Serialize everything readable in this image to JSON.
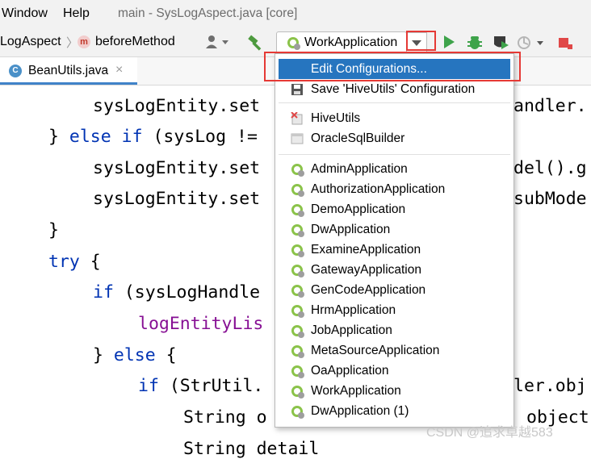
{
  "menubar": {
    "window_menu": "Window",
    "help_menu": "Help",
    "title": "main - SysLogAspect.java [core]"
  },
  "navbar": {
    "crumb_class": "LogAspect",
    "crumb_separator": "〉",
    "crumb_method": "beforeMethod",
    "method_icon": "m",
    "run_config": "WorkApplication"
  },
  "editor_tab": {
    "file_icon": "C",
    "label": "BeanUtils.java",
    "close": "×"
  },
  "code_lines": [
    {
      "parts": [
        "sysLogEntity.set"
      ]
    },
    {
      "parts": [
        "} ",
        "else",
        " ",
        "if",
        " (sysLog !="
      ]
    },
    {
      "parts": [
        "sysLogEntity.set"
      ]
    },
    {
      "parts": [
        "sysLogEntity.set"
      ]
    },
    {
      "parts": [
        "}"
      ]
    },
    {
      "parts": [
        "try",
        " {"
      ]
    },
    {
      "parts": [
        "if",
        " (sysLogHandle"
      ]
    },
    {
      "parts": [
        "logEntityLis"
      ]
    },
    {
      "parts": [
        "} ",
        "else",
        " {"
      ]
    },
    {
      "parts": [
        "if",
        " (StrUtil."
      ]
    },
    {
      "parts": [
        "String o"
      ]
    },
    {
      "parts": [
        "String detail"
      ]
    }
  ],
  "code_right": [
    "andler.",
    "del().g",
    "subMode",
    "ler.obj",
    "object"
  ],
  "dropdown": {
    "edit_configurations": "Edit Configurations...",
    "save_configuration": "Save 'HiveUtils' Configuration",
    "temporary": [
      "HiveUtils",
      "OracleSqlBuilder"
    ],
    "applications": [
      "AdminApplication",
      "AuthorizationApplication",
      "DemoApplication",
      "DwApplication",
      "ExamineApplication",
      "GatewayApplication",
      "GenCodeApplication",
      "HrmApplication",
      "JobApplication",
      "MetaSourceApplication",
      "OaApplication",
      "WorkApplication",
      "DwApplication (1)"
    ]
  },
  "watermark": "CSDN @追求卓越583",
  "colors": {
    "selection": "#2675bf",
    "highlight_box": "#e53935",
    "keyword": "#0033b3",
    "field": "#871094",
    "run_green": "#3ea34a"
  }
}
